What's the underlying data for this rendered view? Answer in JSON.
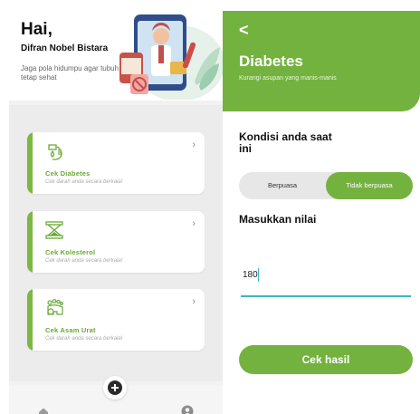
{
  "home": {
    "greeting": "Hai,",
    "user_name": "Difran Nobel Bistara",
    "tagline": "Jaga pola hidumpu agar tubuh tetap sehat",
    "cards": [
      {
        "title": "Cek Diabetes",
        "subtitle": "Cek darah anda secara berkala!",
        "icon": "blood-drop-hand-icon"
      },
      {
        "title": "Cek Kolesterol",
        "subtitle": "Cek darah anda secara berkala!",
        "icon": "hourglass-icon"
      },
      {
        "title": "Cek Asam Urat",
        "subtitle": "Cek darah anda secara berkala!",
        "icon": "foot-icon"
      }
    ],
    "nav": [
      "home-icon",
      "add-icon",
      "profile-icon"
    ]
  },
  "diabetes": {
    "back": "<",
    "title": "Diabetes",
    "subtitle": "Kurangi asupan yang manis-manis",
    "condition_label": "Kondisi anda saat ini",
    "options": [
      "Berpuasa",
      "Tidak berpuasa"
    ],
    "selected_option": "Tidak berpuasa",
    "value_label": "Masukkan nilai",
    "value": "180",
    "submit_label": "Cek hasil"
  },
  "colors": {
    "accent": "#74b23f",
    "input_line": "#3cb7c6",
    "card_title": "#6aa936"
  }
}
